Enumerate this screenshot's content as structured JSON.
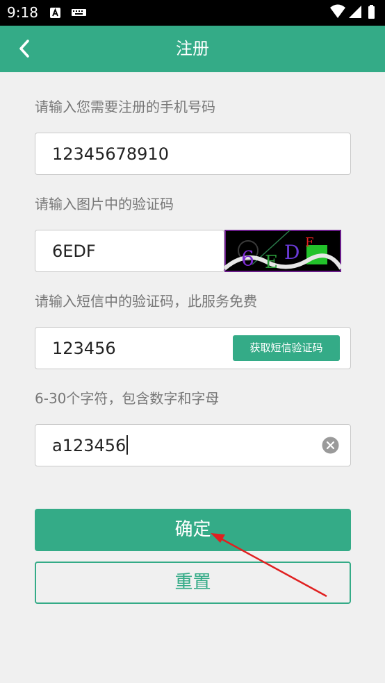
{
  "status_bar": {
    "time": "9:18",
    "icons": [
      "a-notification-icon",
      "keyboard-icon",
      "wifi-icon",
      "signal-icon",
      "battery-icon"
    ]
  },
  "header": {
    "title": "注册",
    "back_icon": "chevron-left-icon"
  },
  "form": {
    "phone": {
      "label": "请输入您需要注册的手机号码",
      "value": "12345678910"
    },
    "captcha": {
      "label": "请输入图片中的验证码",
      "value": "6EDF",
      "image_text": "6EDF"
    },
    "sms": {
      "label": "请输入短信中的验证码，此服务免费",
      "value": "123456",
      "button_label": "获取短信验证码"
    },
    "password": {
      "label": "6-30个字符，包含数字和字母",
      "value": "a123456",
      "clear_icon": "clear-icon"
    }
  },
  "actions": {
    "confirm_label": "确定",
    "reset_label": "重置"
  },
  "colors": {
    "accent": "#34ab87",
    "annotation_arrow": "#e02020"
  }
}
